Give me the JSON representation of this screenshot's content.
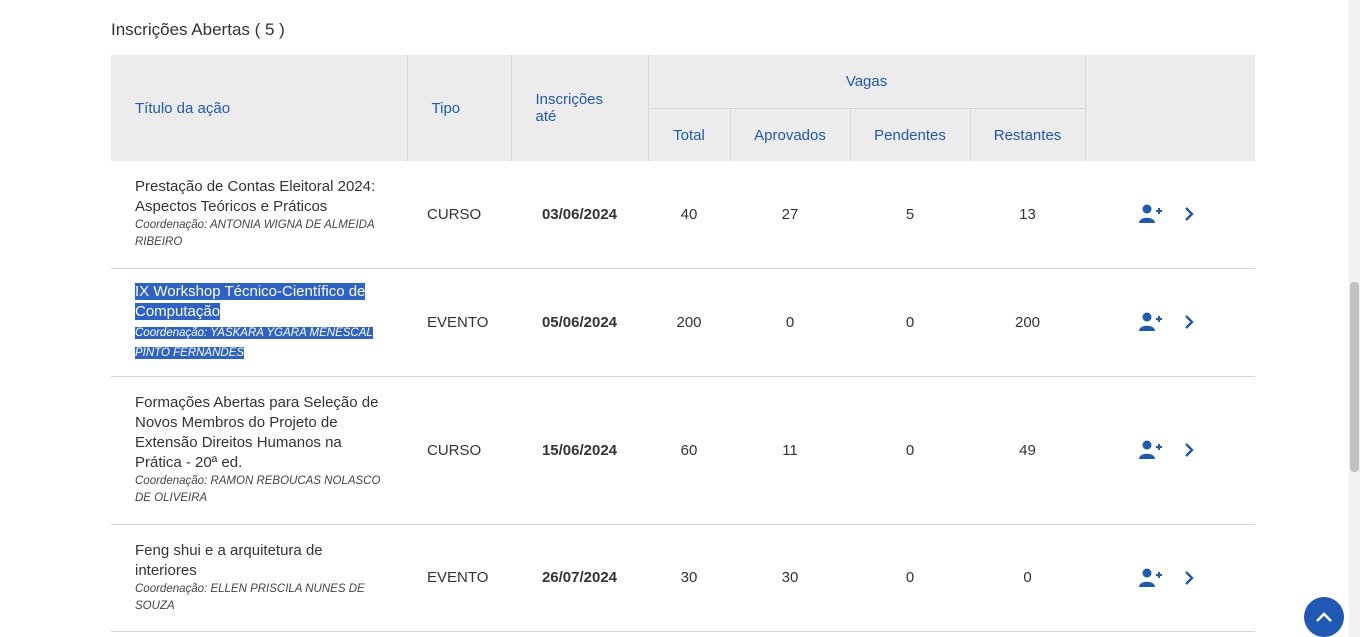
{
  "section": {
    "title": "Inscrições Abertas ( 5 )"
  },
  "table": {
    "headers": {
      "titulo": "Título da ação",
      "tipo": "Tipo",
      "inscricoes_ate": "Inscrições até",
      "vagas": "Vagas",
      "total": "Total",
      "aprovados": "Aprovados",
      "pendentes": "Pendentes",
      "restantes": "Restantes"
    },
    "rows": [
      {
        "title": "Prestação de Contas Eleitoral 2024: Aspectos Teóricos e Práticos",
        "coord": "Coordenação: ANTONIA WIGNA DE ALMEIDA RIBEIRO",
        "tipo": "CURSO",
        "ate": "03/06/2024",
        "total": "40",
        "aprovados": "27",
        "pendentes": "5",
        "restantes": "13"
      },
      {
        "title": "IX Workshop Técnico-Científico de Computação",
        "coord": "Coordenação: YASKARA YGARA MENESCAL PINTO FERNANDES",
        "tipo": "EVENTO",
        "ate": "05/06/2024",
        "total": "200",
        "aprovados": "0",
        "pendentes": "0",
        "restantes": "200",
        "selected": true
      },
      {
        "title": "Formações Abertas para Seleção de Novos Membros do Projeto de Extensão Direitos Humanos na Prática - 20ª ed.",
        "coord": "Coordenação: RAMON REBOUCAS NOLASCO DE OLIVEIRA",
        "tipo": "CURSO",
        "ate": "15/06/2024",
        "total": "60",
        "aprovados": "11",
        "pendentes": "0",
        "restantes": "49"
      },
      {
        "title": "Feng shui e a arquitetura de interiores",
        "coord": "Coordenação: ELLEN PRISCILA NUNES DE SOUZA",
        "tipo": "EVENTO",
        "ate": "26/07/2024",
        "total": "30",
        "aprovados": "30",
        "pendentes": "0",
        "restantes": "0"
      }
    ]
  },
  "icons": {
    "enroll": "user-plus-icon",
    "details": "chevron-right-icon",
    "back_to_top": "chevron-up-icon"
  },
  "colors": {
    "accent": "#1f59b4",
    "header_bg": "#ececec",
    "selection": "#2d63c8"
  }
}
